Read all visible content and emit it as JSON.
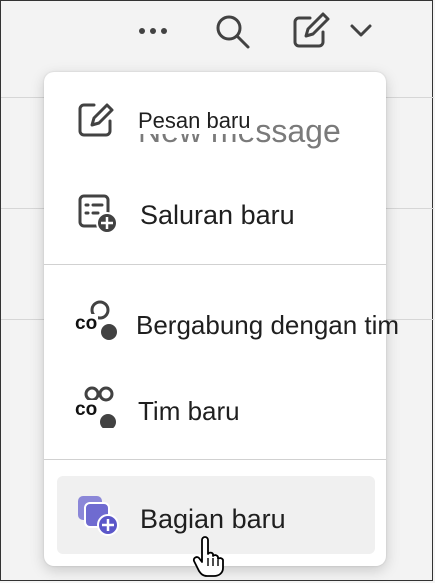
{
  "toolbar": {
    "more_icon": "more-horizontal-icon",
    "search_icon": "search-icon",
    "compose_icon": "compose-icon",
    "chevron_icon": "chevron-down-icon"
  },
  "menu": {
    "items": [
      {
        "label": "Pesan baru",
        "overlay_text": "New message",
        "icon": "compose-icon"
      },
      {
        "label": "Saluran baru",
        "icon": "new-channel-icon"
      },
      {
        "label": "Bergabung dengan tim",
        "icon_text": "co",
        "icon": "people-team-icon"
      },
      {
        "label": "Tim baru",
        "icon_text": "co",
        "icon": "people-team-add-icon"
      },
      {
        "label": "Bagian baru",
        "icon": "new-section-icon"
      }
    ]
  },
  "cursor_icon": "hand-pointer-icon"
}
